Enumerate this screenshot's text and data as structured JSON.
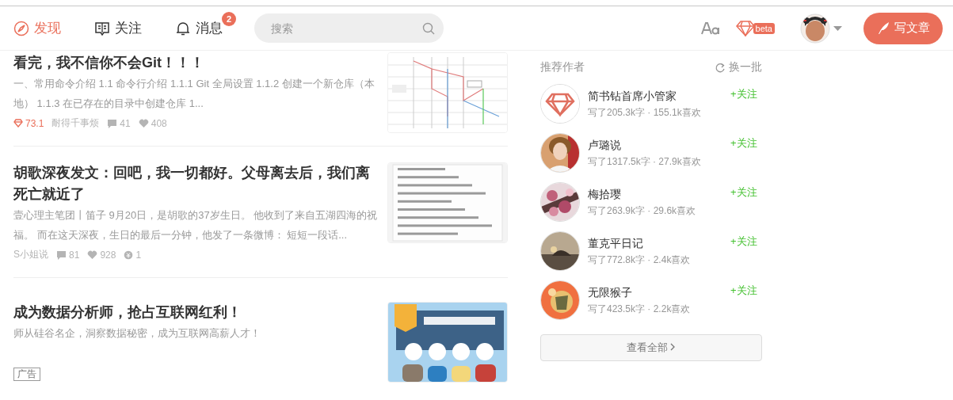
{
  "header": {
    "nav": [
      {
        "label": "发现",
        "kind": "discover",
        "selected": true
      },
      {
        "label": "关注",
        "kind": "follow",
        "selected": false
      },
      {
        "label": "消息",
        "kind": "messages",
        "selected": false,
        "badge": "2"
      }
    ],
    "search": {
      "placeholder": "搜索"
    },
    "beta_badge": "beta",
    "write_button": "写文章"
  },
  "articles": [
    {
      "kind": "post",
      "title": "看完，我不信你不会Git！！！",
      "summary": "一、常用命令介绍 1.1 命令行介绍 1.1.1 Git 全局设置 1.1.2 创建一个新仓库（本地） 1.1.3 在已存在的目录中创建仓库 1...",
      "meta": [
        {
          "kind": "diamond",
          "text": "73.1"
        },
        {
          "kind": "author",
          "text": "耐得千事烦"
        },
        {
          "kind": "comments",
          "text": "41"
        },
        {
          "kind": "likes",
          "text": "408"
        }
      ]
    },
    {
      "kind": "post",
      "title": "胡歌深夜发文：回吧，我一切都好。父母离去后，我们离死亡就近了",
      "summary": "壹心理主笔团丨笛子 9月20日，是胡歌的37岁生日。 他收到了来自五湖四海的祝福。 而在这天深夜，生日的最后一分钟，他发了一条微博： 短短一段话...",
      "meta": [
        {
          "kind": "author",
          "text": "S小姐说"
        },
        {
          "kind": "comments",
          "text": "81"
        },
        {
          "kind": "likes",
          "text": "928"
        },
        {
          "kind": "rewards",
          "text": "1"
        }
      ]
    },
    {
      "kind": "ad",
      "title": "成为数据分析师，抢占互联网红利！",
      "summary": "师从硅谷名企，洞察数据秘密，成为互联网高薪人才！",
      "tag": "广告"
    }
  ],
  "recommended": {
    "title": "推荐作者",
    "refresh": "换一批",
    "authors": [
      {
        "name": "简书钻首席小管家",
        "stats": "写了205.3k字 · 155.1k喜欢",
        "follow": "+关注"
      },
      {
        "name": "卢璐说",
        "stats": "写了1317.5k字 · 27.9k喜欢",
        "follow": "+关注"
      },
      {
        "name": "梅拾璎",
        "stats": "写了263.9k字 · 29.6k喜欢",
        "follow": "+关注"
      },
      {
        "name": "董克平日记",
        "stats": "写了772.8k字 · 2.4k喜欢",
        "follow": "+关注"
      },
      {
        "name": "无限猴子",
        "stats": "写了423.5k字 · 2.2k喜欢",
        "follow": "+关注"
      }
    ],
    "see_all": "查看全部"
  }
}
